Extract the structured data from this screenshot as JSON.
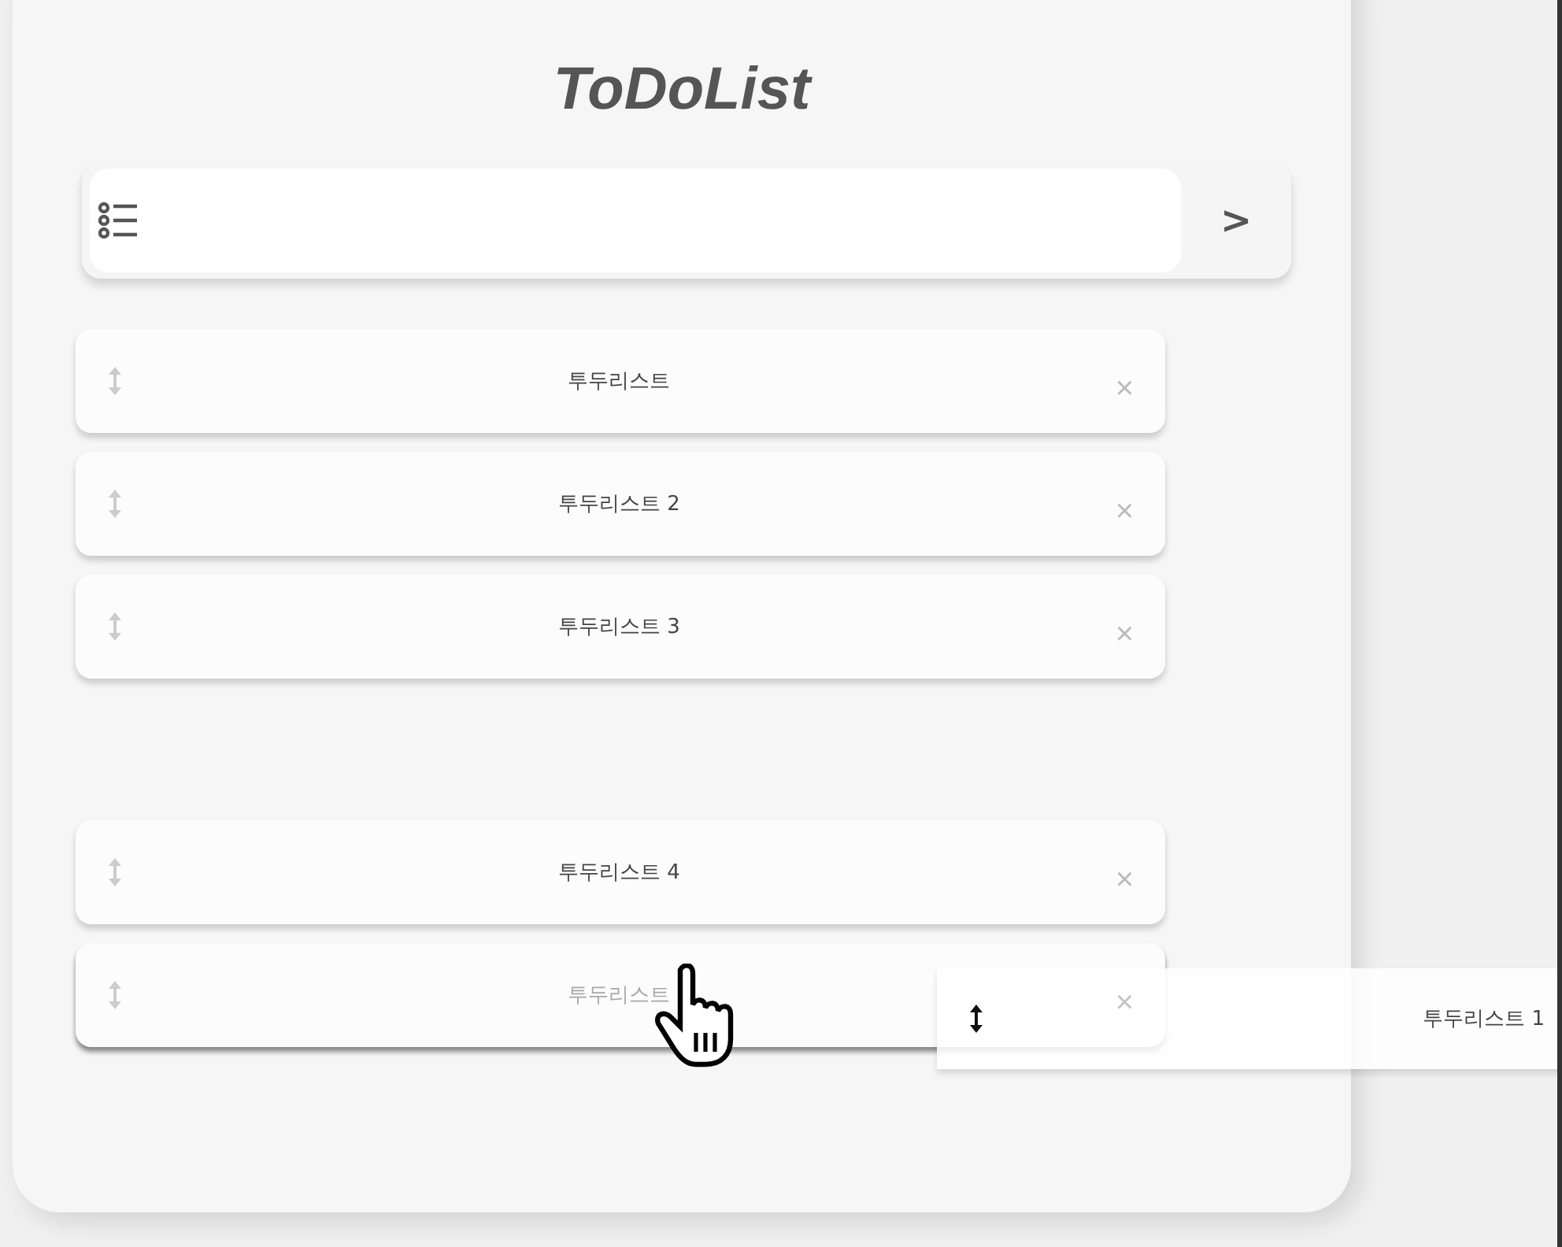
{
  "title": "ToDoList",
  "input": {
    "submit": ">"
  },
  "rows": [
    {
      "kind": "item",
      "label": "투두리스트",
      "delete": "×"
    },
    {
      "kind": "item",
      "label": "투두리스트 2",
      "delete": "×"
    },
    {
      "kind": "item",
      "label": "투두리스트 3",
      "delete": "×"
    },
    {
      "kind": "slot"
    },
    {
      "kind": "item",
      "label": "투두리스트 4",
      "delete": "×"
    },
    {
      "kind": "ghost",
      "label": "투두리스트",
      "delete": "×"
    }
  ],
  "dragged": {
    "label": "투두리스트 1"
  }
}
